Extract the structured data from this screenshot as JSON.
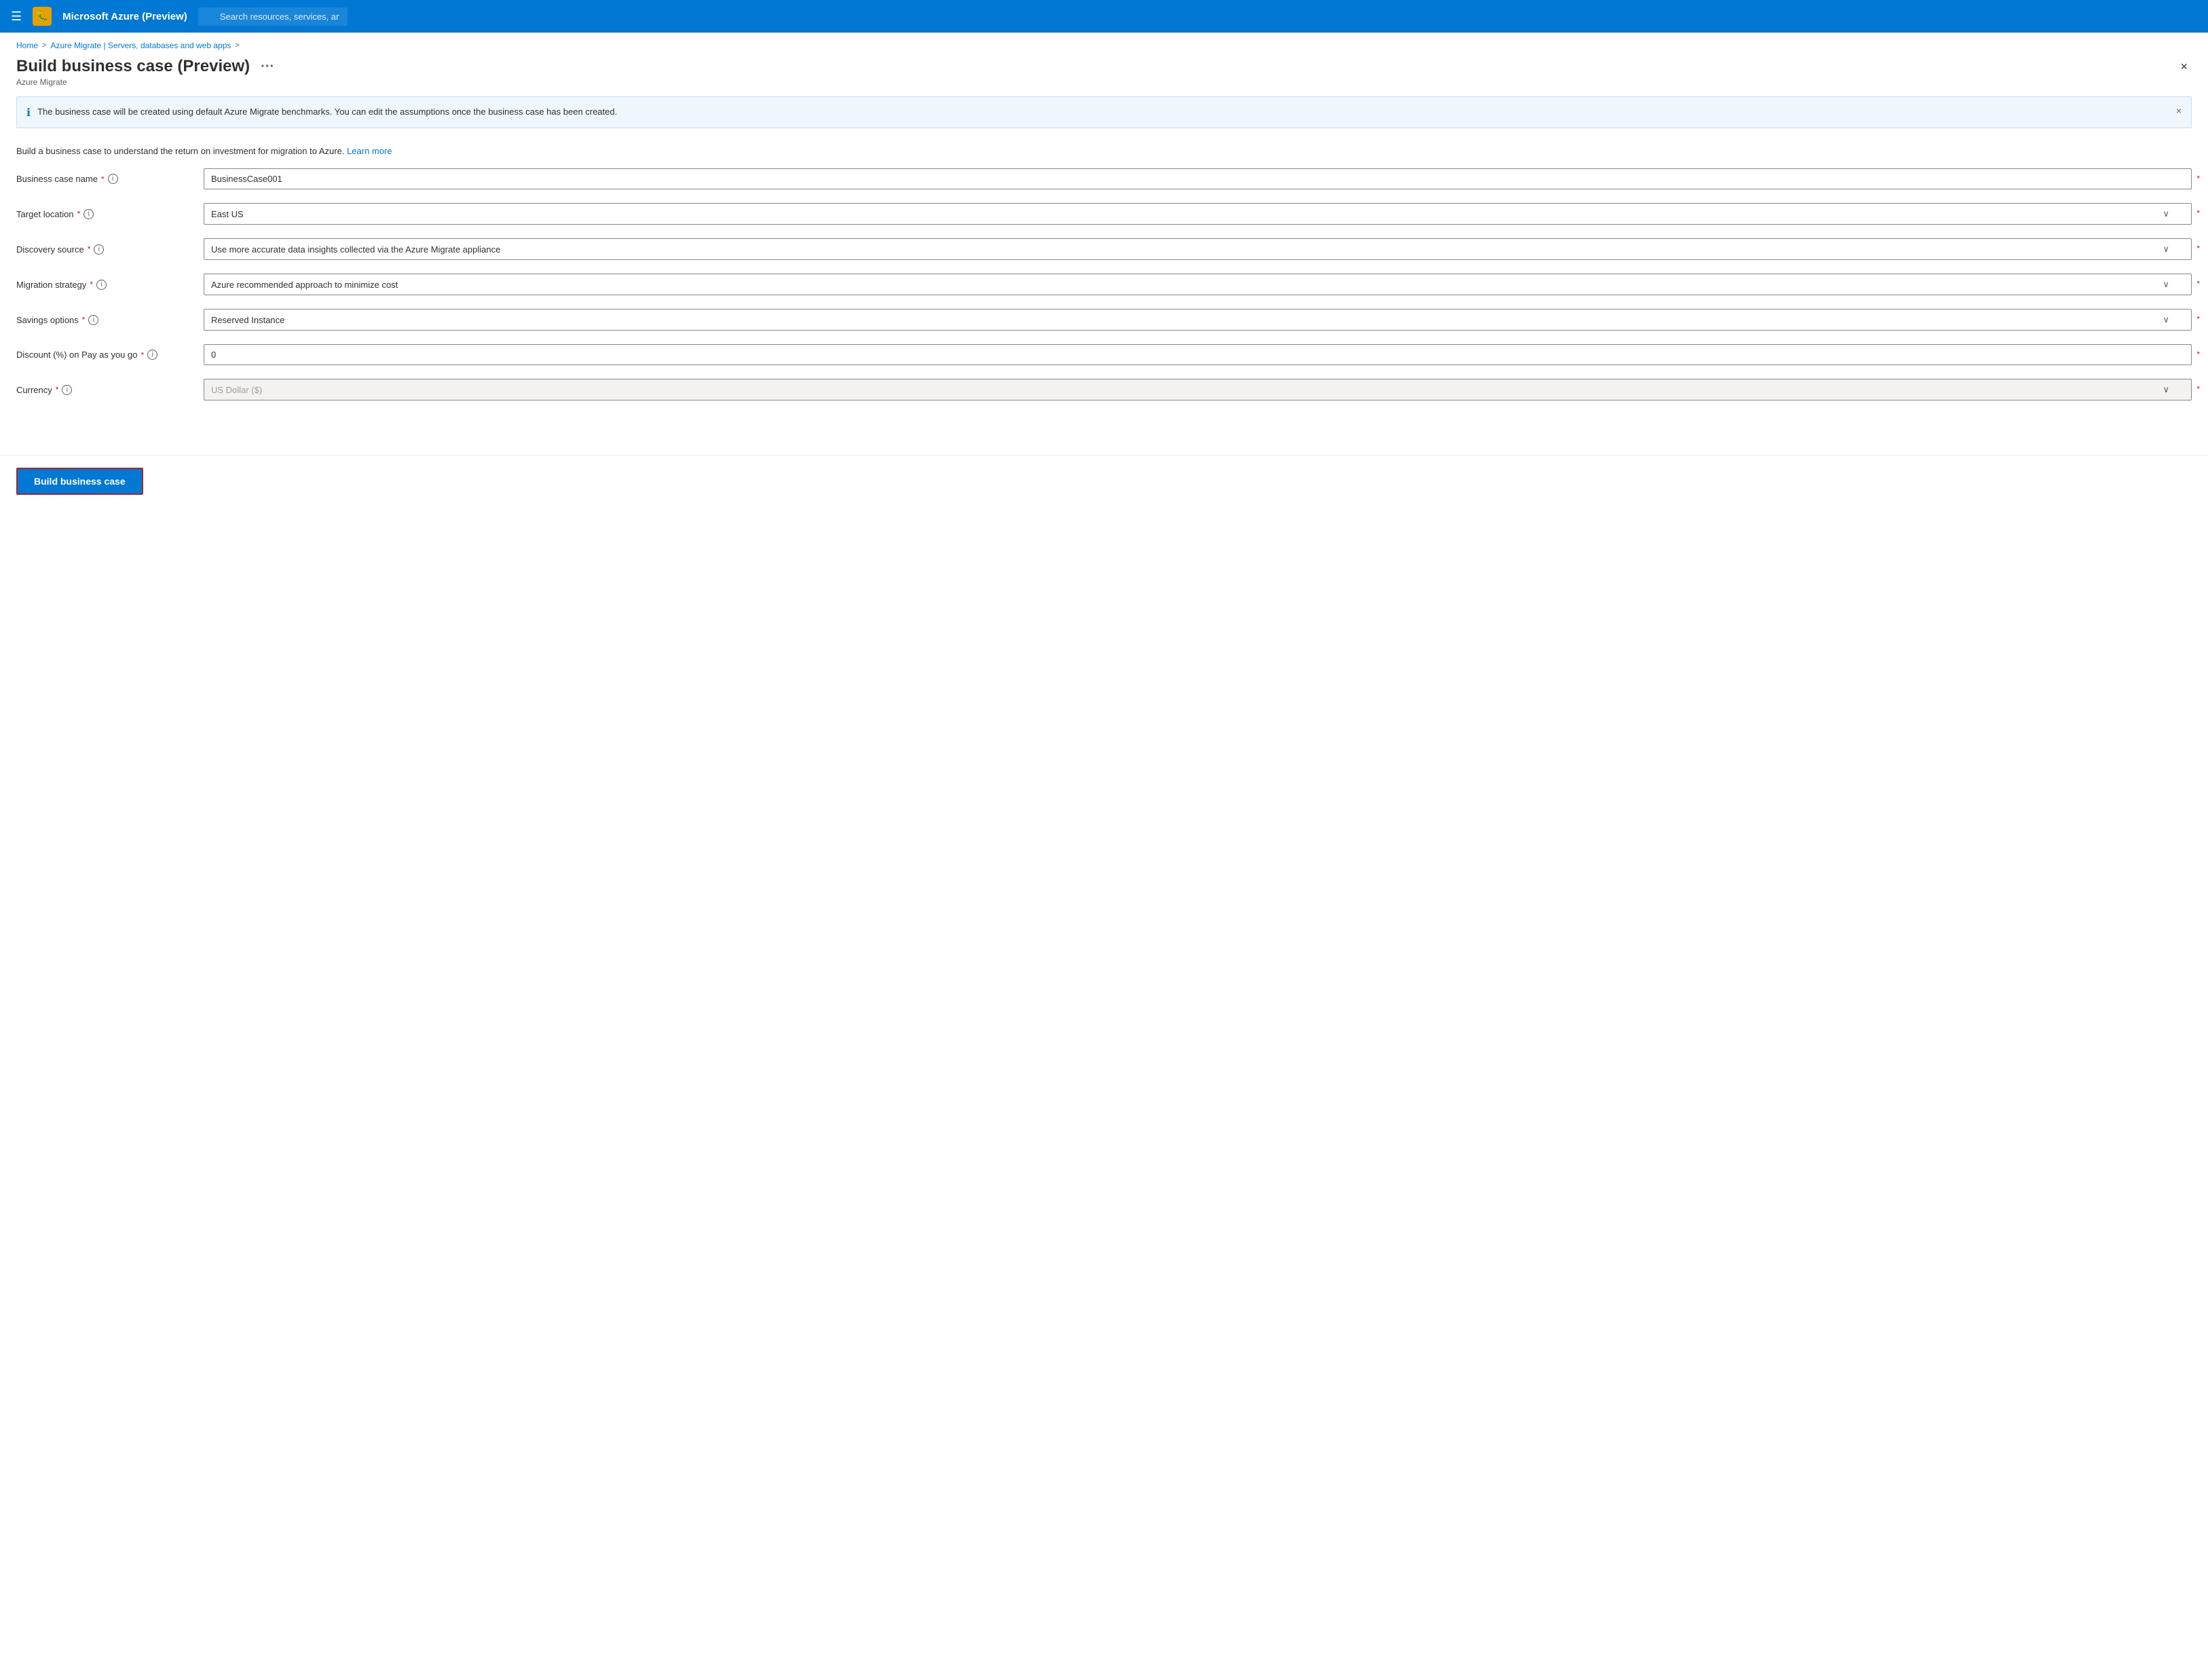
{
  "topbar": {
    "hamburger_icon": "☰",
    "title": "Microsoft Azure (Preview)",
    "bug_icon": "🐛",
    "search_placeholder": "Search resources, services, and docs (G+/)"
  },
  "breadcrumb": {
    "items": [
      "Home",
      "Azure Migrate | Servers, databases and web apps"
    ],
    "separators": [
      ">",
      ">"
    ]
  },
  "panel": {
    "title": "Build business case (Preview)",
    "more_label": "···",
    "close_label": "×",
    "subtitle": "Azure Migrate"
  },
  "info_banner": {
    "text": "The business case will be created using default Azure Migrate benchmarks. You can edit the assumptions once the business case has been created.",
    "close_label": "×"
  },
  "description": {
    "text": "Build a business case to understand the return on investment for migration to Azure.",
    "learn_more": "Learn more"
  },
  "form": {
    "fields": [
      {
        "label": "Business case name",
        "id": "business-case-name",
        "type": "input",
        "value": "BusinessCase001",
        "placeholder": ""
      },
      {
        "label": "Target location",
        "id": "target-location",
        "type": "select",
        "value": "East US",
        "disabled": false
      },
      {
        "label": "Discovery source",
        "id": "discovery-source",
        "type": "select",
        "value": "Use more accurate data insights collected via the Azure Migrate appliance",
        "disabled": false
      },
      {
        "label": "Migration strategy",
        "id": "migration-strategy",
        "type": "select",
        "value": "Azure recommended approach to minimize cost",
        "disabled": false
      },
      {
        "label": "Savings options",
        "id": "savings-options",
        "type": "select",
        "value": "Reserved Instance",
        "disabled": false
      },
      {
        "label": "Discount (%) on Pay as you go",
        "id": "discount",
        "type": "input",
        "value": "0",
        "placeholder": ""
      },
      {
        "label": "Currency",
        "id": "currency",
        "type": "select",
        "value": "US Dollar ($)",
        "disabled": true
      }
    ]
  },
  "build_button": {
    "label": "Build business case"
  }
}
